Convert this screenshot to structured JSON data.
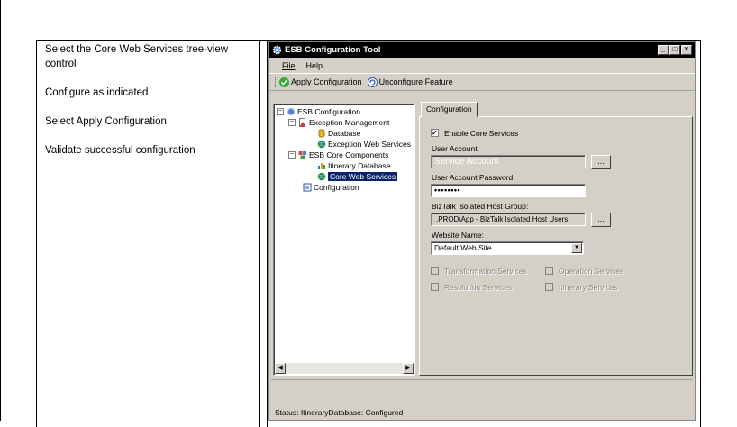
{
  "instructions": [
    "Select the Core Web Services tree-view control",
    "Configure as indicated",
    "Select Apply Configuration",
    "Validate successful configuration"
  ],
  "window": {
    "title": "ESB Configuration Tool",
    "menu": {
      "file": "File",
      "help": "Help"
    },
    "toolbar": {
      "apply": "Apply Configuration",
      "unconfigure": "Unconfigure Feature"
    }
  },
  "tree": {
    "root": "ESB Configuration",
    "exception_management": "Exception Management",
    "database": "Database",
    "exception_web_services": "Exception Web Services",
    "core_components": "ESB Core Components",
    "itinerary_database": "Itinerary Database",
    "core_web_services": "Core Web Services",
    "configuration": "Configuration"
  },
  "tab": {
    "label": "Configuration"
  },
  "form": {
    "enable_core_services": "Enable Core Services",
    "user_account_label": "User Account:",
    "user_account_value": "Service Account",
    "password_label": "User Account Password:",
    "password_value": "••••••••",
    "host_group_label": "BizTalk Isolated Host Group:",
    "host_group_value": ".PROD\\App - BizTalk Isolated Host Users",
    "website_label": "Website Name:",
    "website_value": "Default Web Site",
    "ellipsis": "...",
    "transformation": "Transformation Services",
    "operation": "Operation Services",
    "resolution": "Resolution Services",
    "itinerary": "Itinerary Services"
  },
  "status": "Status:  ItineraryDatabase: Configured",
  "colors": {
    "titlebar": "#000000",
    "selection": "#0a246a",
    "face": "#d4d0c8"
  }
}
